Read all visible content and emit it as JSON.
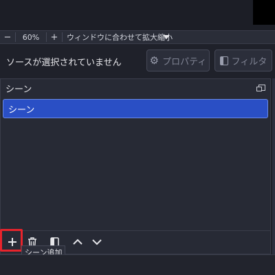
{
  "zoom_bar": {
    "minus_label": "−",
    "zoom_value": "60%",
    "plus_label": "+",
    "mode_label": "ウィンドウに合わせて拡大縮小"
  },
  "source_bar": {
    "status_text": "ソースが選択されていません",
    "properties_label": "プロパティ",
    "filters_label": "フィルタ"
  },
  "scenes_dock": {
    "title": "シーン",
    "scenes": [
      {
        "label": "シーン",
        "selected": true
      }
    ],
    "toolbar": {
      "add_tooltip": "シーン追加"
    }
  },
  "icons": {
    "dock_float": "float-icon",
    "add": "plus-icon",
    "remove": "trash-icon",
    "filter": "filter-icon",
    "move_up": "chevron-up-icon",
    "move_down": "chevron-down-icon",
    "properties": "gear-icon"
  },
  "colors": {
    "selection": "#2a4fc5",
    "highlight": "#e8242c",
    "panel": "#272a35",
    "background": "#1f212a"
  }
}
